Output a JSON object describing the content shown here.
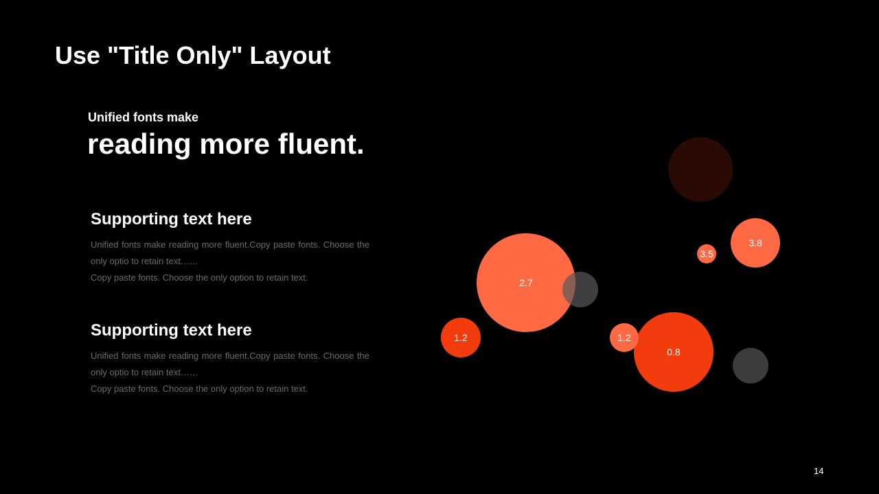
{
  "slide": {
    "title": "Use \"Title Only\" Layout",
    "kicker": "Unified fonts make",
    "headline": "reading more fluent.",
    "page_number": "14"
  },
  "blocks": [
    {
      "heading": "Supporting text here",
      "line1": "Unified  fonts make reading more fluent.Copy paste fonts. Choose the only optio to retain text……",
      "line2": "Copy paste  fonts. Choose the only option to retain text."
    },
    {
      "heading": "Supporting text here",
      "line1": "Unified  fonts make reading more fluent.Copy paste fonts. Choose the only optio to retain text……",
      "line2": "Copy paste  fonts. Choose the only option to retain text."
    }
  ],
  "colors": {
    "background": "#000000",
    "text": "#ffffff",
    "muted_text": "#6b6b6b",
    "coral": "#ff6a45",
    "red": "#f23c0d",
    "dark_red": "#2a0a04",
    "gray": "#3c3c3c"
  },
  "chart_data": {
    "type": "scatter",
    "bubbles": [
      {
        "label": "",
        "color": "#2a0a04",
        "opacity": 1
      },
      {
        "label": "3.8",
        "color": "#ff6a45",
        "opacity": 1
      },
      {
        "label": "3.5",
        "color": "#ff6a45",
        "opacity": 1
      },
      {
        "label": "2.7",
        "color": "#ff6a45",
        "opacity": 1
      },
      {
        "label": "",
        "color": "#5a5a5a",
        "opacity": 0.7
      },
      {
        "label": "1.2",
        "color": "#f23c0d",
        "opacity": 1
      },
      {
        "label": "0.8",
        "color": "#f23c0d",
        "opacity": 1
      },
      {
        "label": "1.2",
        "color": "#ff6a45",
        "opacity": 1
      },
      {
        "label": "",
        "color": "#3c3c3c",
        "opacity": 1
      }
    ]
  }
}
